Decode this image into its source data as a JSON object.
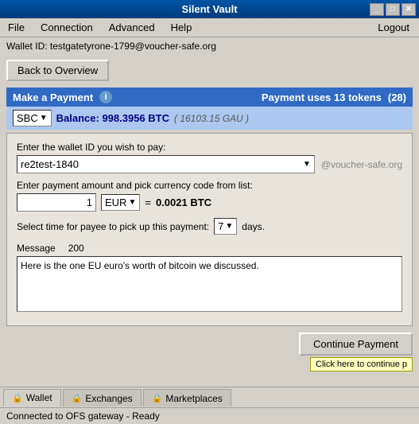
{
  "titlebar": {
    "title": "Silent Vault",
    "controls": [
      "_",
      "□",
      "✕"
    ]
  },
  "menubar": {
    "items": [
      "File",
      "Connection",
      "Advanced",
      "Help"
    ],
    "logout_label": "Logout"
  },
  "wallet_id_bar": {
    "label": "Wallet ID: testgatetyrone-1799@voucher-safe.org"
  },
  "back_button": {
    "label": "Back to Overview"
  },
  "payment_header": {
    "title": "Make a Payment",
    "info_symbol": "i",
    "tokens_text": "Payment uses 13 tokens",
    "tokens_count": "(28)"
  },
  "currency_row": {
    "currency": "SBC",
    "balance_label": "Balance: 998.3956 BTC",
    "gau_label": "( 16103.15 GAU )"
  },
  "form": {
    "wallet_label": "Enter the wallet ID you wish to pay:",
    "wallet_value": "re2test-1840",
    "wallet_suffix": "@voucher-safe.org",
    "amount_label": "Enter payment amount and pick currency code from list:",
    "amount_value": "1",
    "currency_code": "EUR",
    "equals": "=",
    "btc_equiv": "0.0021 BTC",
    "time_label": "Select time for payee to pick up this payment:",
    "days_value": "7",
    "days_label": "days.",
    "message_label": "Message",
    "message_count": "200",
    "message_value": "Here is the one EU euro's worth of bitcoin we discussed."
  },
  "continue_button": {
    "label": "Continue Payment",
    "tooltip": "Click here to continue p"
  },
  "tabs": [
    {
      "label": "Wallet",
      "icon": "🔒",
      "active": true
    },
    {
      "label": "Exchanges",
      "icon": "🔒",
      "active": false
    },
    {
      "label": "Marketplaces",
      "icon": "🔒",
      "active": false
    }
  ],
  "statusbar": {
    "text": "Connected to OFS gateway - Ready"
  }
}
